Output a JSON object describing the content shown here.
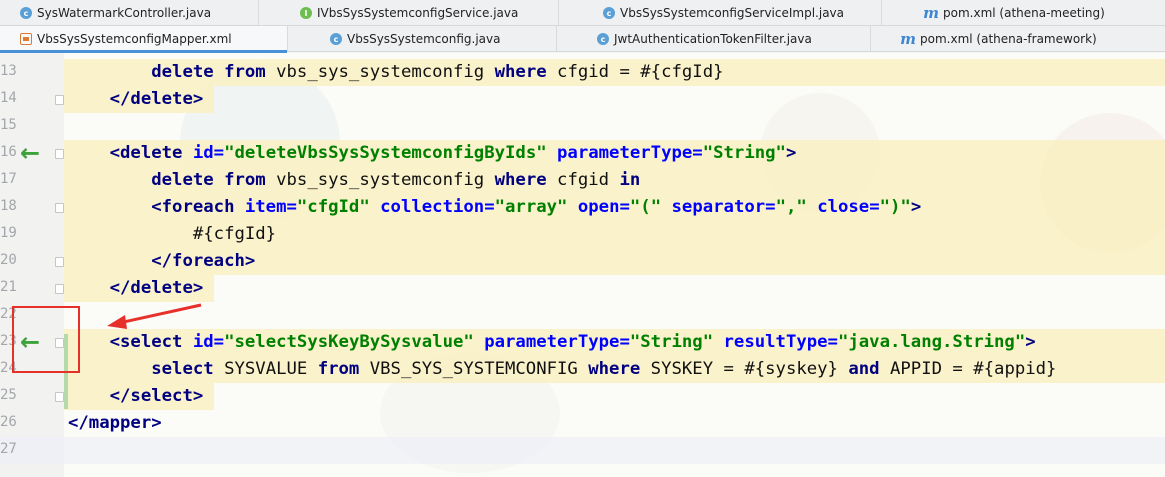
{
  "tabs_row1": [
    {
      "icon": "class-icon",
      "label": "SysWatermarkController.java"
    },
    {
      "icon": "interface-icon",
      "label": "IVbsSysSystemconfigService.java"
    },
    {
      "icon": "class-icon",
      "label": "VbsSysSystemconfigServiceImpl.java"
    },
    {
      "icon": "maven-icon",
      "label": "pom.xml (athena-meeting)"
    }
  ],
  "tabs_row2": [
    {
      "icon": "xml-icon",
      "label": "VbsSysSystemconfigMapper.xml",
      "active": true
    },
    {
      "icon": "class-icon",
      "label": "VbsSysSystemconfig.java"
    },
    {
      "icon": "class-icon",
      "label": "JwtAuthenticationTokenFilter.java"
    },
    {
      "icon": "maven-icon",
      "label": "pom.xml (athena-framework)"
    }
  ],
  "code_lines": [
    {
      "n": "13",
      "text": "        delete from vbs_sys_systemconfig where cfgid = #{cfgId}"
    },
    {
      "n": "14",
      "text": "    </delete>"
    },
    {
      "n": "15",
      "text": ""
    },
    {
      "n": "16",
      "text": "    <delete id=\"deleteVbsSysSystemconfigByIds\" parameterType=\"String\">"
    },
    {
      "n": "17",
      "text": "        delete from vbs_sys_systemconfig where cfgid in"
    },
    {
      "n": "18",
      "text": "        <foreach item=\"cfgId\" collection=\"array\" open=\"(\" separator=\",\" close=\")\">"
    },
    {
      "n": "19",
      "text": "            #{cfgId}"
    },
    {
      "n": "20",
      "text": "        </foreach>"
    },
    {
      "n": "21",
      "text": "    </delete>"
    },
    {
      "n": "22",
      "text": ""
    },
    {
      "n": "23",
      "text": "    <select id=\"selectSysKeyBySysvalue\" parameterType=\"String\" resultType=\"java.lang.String\">"
    },
    {
      "n": "24",
      "text": "        select SYSVALUE from VBS_SYS_SYSTEMCONFIG where SYSKEY = #{syskey} and APPID = #{appid}"
    },
    {
      "n": "25",
      "text": "    </select>"
    },
    {
      "n": "26",
      "text": "</mapper>"
    },
    {
      "n": "27",
      "text": ""
    }
  ],
  "gutter_icons": {
    "line16": "implementing-method-arrow-icon",
    "line23": "implementing-method-arrow-icon",
    "arrow_glyph": "←"
  },
  "colors": {
    "tag": "#000080",
    "attr": "#0000ff",
    "value": "#008000",
    "highlight": "#faf0be",
    "annotation": "#e8302a",
    "gutter_arrow": "#3ea23a"
  }
}
